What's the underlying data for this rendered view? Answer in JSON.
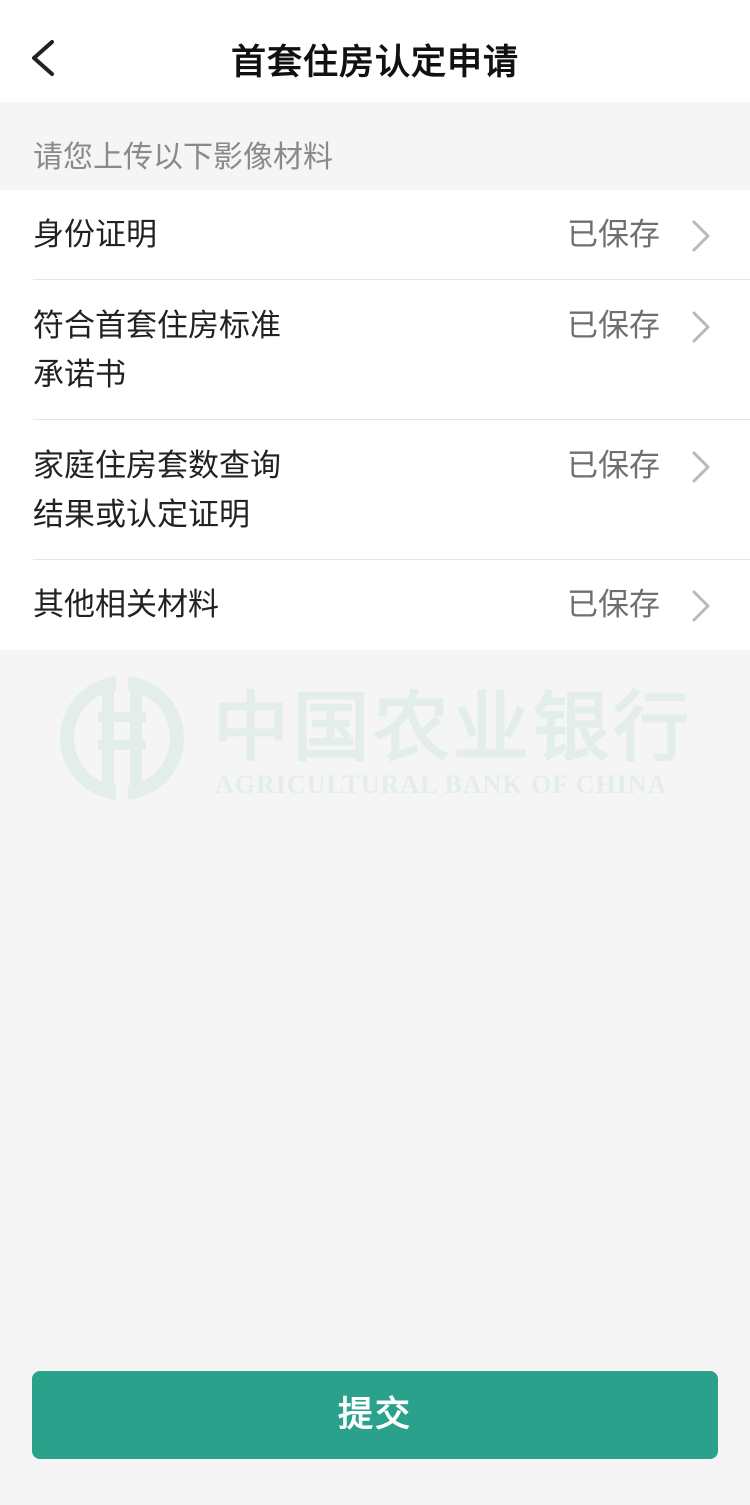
{
  "header": {
    "title": "首套住房认定申请",
    "back_icon": "chevron-left-icon"
  },
  "section": {
    "hint": "请您上传以下影像材料"
  },
  "materials": [
    {
      "label_lines": [
        "身份证明"
      ],
      "status": "已保存"
    },
    {
      "label_lines": [
        "符合首套住房标准",
        "承诺书"
      ],
      "status": "已保存"
    },
    {
      "label_lines": [
        "家庭住房套数查询",
        "结果或认定证明"
      ],
      "status": "已保存"
    },
    {
      "label_lines": [
        "其他相关材料"
      ],
      "status": "已保存"
    }
  ],
  "watermark": {
    "name_cn": "中国农业银行",
    "name_en": "AGRICULTURAL BANK OF CHINA"
  },
  "footer": {
    "submit_label": "提交"
  },
  "colors": {
    "accent": "#2aa18b",
    "watermark": "#cfe6e2"
  }
}
